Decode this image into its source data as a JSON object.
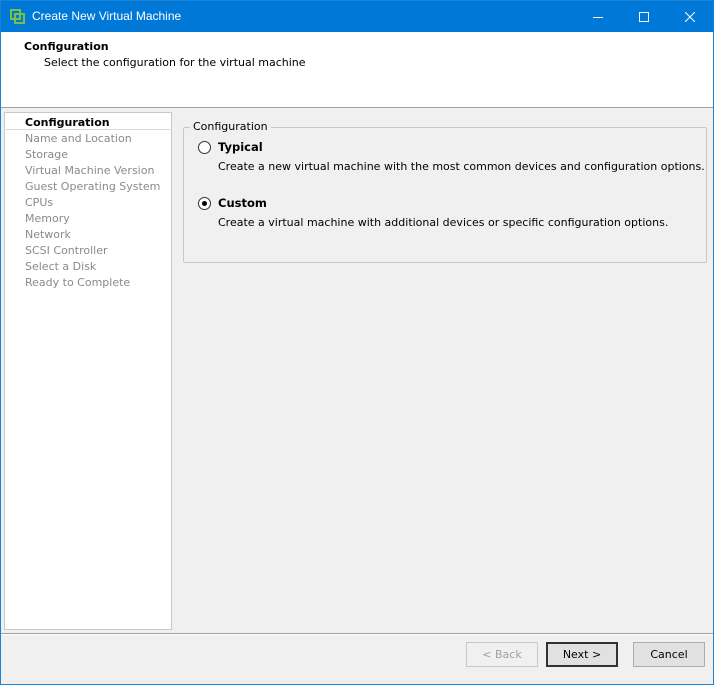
{
  "window": {
    "title": "Create New Virtual Machine",
    "accent_color": "#0078d7",
    "icon": "vsphere-icon"
  },
  "header": {
    "title": "Configuration",
    "subtitle": "Select the configuration for the virtual machine"
  },
  "steps": [
    {
      "label": "Configuration",
      "current": true
    },
    {
      "label": "Name and Location",
      "current": false
    },
    {
      "label": "Storage",
      "current": false
    },
    {
      "label": "Virtual Machine Version",
      "current": false
    },
    {
      "label": "Guest Operating System",
      "current": false
    },
    {
      "label": "CPUs",
      "current": false
    },
    {
      "label": "Memory",
      "current": false
    },
    {
      "label": "Network",
      "current": false
    },
    {
      "label": "SCSI Controller",
      "current": false
    },
    {
      "label": "Select a Disk",
      "current": false
    },
    {
      "label": "Ready to Complete",
      "current": false
    }
  ],
  "configuration": {
    "group_label": "Configuration",
    "options": [
      {
        "label": "Typical",
        "description": "Create a new virtual machine with the most common devices and configuration options.",
        "selected": false
      },
      {
        "label": "Custom",
        "description": "Create a virtual machine with additional devices or specific configuration options.",
        "selected": true
      }
    ]
  },
  "footer": {
    "back_label": "< Back",
    "next_label": "Next >",
    "cancel_label": "Cancel"
  }
}
